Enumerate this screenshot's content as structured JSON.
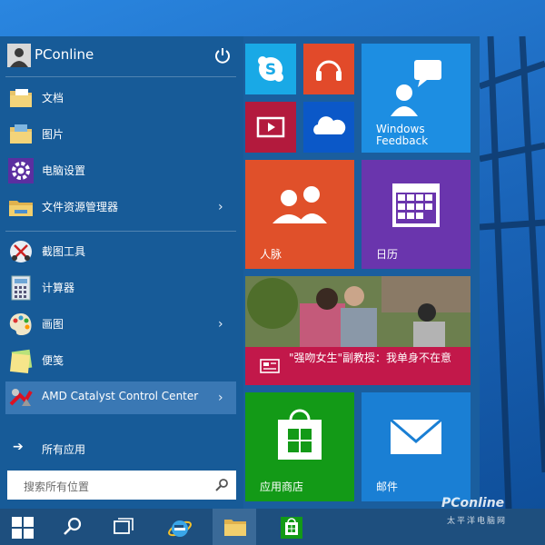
{
  "user": {
    "name": "PConline"
  },
  "menu": {
    "items": [
      {
        "label": "文档",
        "icon": "folder-documents-icon",
        "chevron": ""
      },
      {
        "label": "图片",
        "icon": "folder-pictures-icon",
        "chevron": ""
      },
      {
        "label": "电脑设置",
        "icon": "gear-icon",
        "chevron": ""
      },
      {
        "label": "文件资源管理器",
        "icon": "file-explorer-icon",
        "chevron": "›"
      },
      {
        "label": "截图工具",
        "icon": "snipping-tool-icon",
        "chevron": ""
      },
      {
        "label": "计算器",
        "icon": "calculator-icon",
        "chevron": ""
      },
      {
        "label": "画图",
        "icon": "paint-icon",
        "chevron": "›"
      },
      {
        "label": "便笺",
        "icon": "sticky-notes-icon",
        "chevron": ""
      },
      {
        "label": "AMD Catalyst Control Center",
        "icon": "amd-catalyst-icon",
        "chevron": "›"
      }
    ],
    "all_apps_arrow": "➔",
    "all_apps_label": "所有应用"
  },
  "search": {
    "placeholder": "搜索所有位置"
  },
  "tiles": {
    "feedback_label": "Windows Feedback",
    "people_label": "人脉",
    "calendar_label": "日历",
    "news_headline": "\"强吻女生\"副教授：我单身不在意",
    "store_label": "应用商店",
    "mail_label": "邮件"
  },
  "colors": {
    "skype": "#19a9e6",
    "music": "#e24a2a",
    "video": "#b31a3d",
    "onedrive": "#0b58c8",
    "feedback": "#1d8ee2",
    "people": "#e0502a",
    "calendar": "#6a35ad",
    "news": "#c2184a",
    "store": "#139a17",
    "mail": "#1a7fd4"
  },
  "taskbar": {
    "items": [
      "windows-start-icon",
      "search-icon",
      "task-view-icon",
      "internet-explorer-icon",
      "file-explorer-icon",
      "store-icon"
    ]
  },
  "watermark": {
    "brand": "PConline",
    "sub": "太平洋电脑网"
  }
}
